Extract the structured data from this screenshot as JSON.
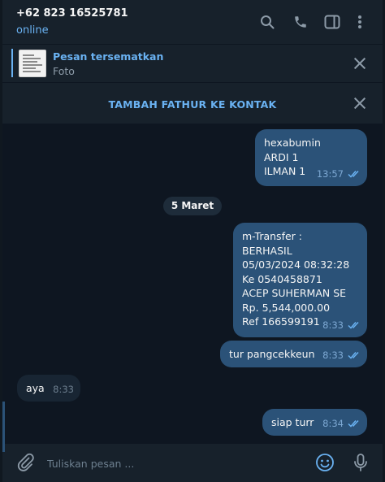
{
  "header": {
    "contact_name": "+62 823 16525781",
    "status": "online",
    "icons": [
      "search-icon",
      "phone-icon",
      "sidebar-toggle-icon",
      "more-vertical-icon"
    ]
  },
  "pinned": {
    "title": "Pesan tersematkan",
    "subtitle": "Foto"
  },
  "add_contact": {
    "label": "TAMBAH FATHUR KE KONTAK"
  },
  "date_separator": "5 Maret",
  "messages": [
    {
      "direction": "out",
      "lines": [
        "hexabumin",
        "ARDI 1",
        "ILMAN 1"
      ],
      "time": "13:57",
      "read": true
    },
    {
      "direction": "out",
      "lines": [
        "m-Transfer :",
        "BERHASIL",
        "05/03/2024 08:32:28",
        "Ke 0540458871",
        "ACEP SUHERMAN SE",
        "Rp. 5,544,000.00",
        "Ref 166599191"
      ],
      "time": "8:33",
      "read": true
    },
    {
      "direction": "out",
      "lines": [
        "tur pangcekkeun"
      ],
      "time": "8:33",
      "read": true
    },
    {
      "direction": "in",
      "lines": [
        "aya"
      ],
      "time": "8:33"
    },
    {
      "direction": "out",
      "lines": [
        "siap turr"
      ],
      "time": "8:34",
      "read": true
    }
  ],
  "composer": {
    "placeholder": "Tuliskan pesan ...",
    "icons": [
      "attach-icon",
      "emoji-icon",
      "microphone-icon"
    ]
  },
  "colors": {
    "background": "#0e1621",
    "panel": "#17212b",
    "outgoing_bubble": "#2b5278",
    "incoming_bubble": "#182533",
    "accent": "#6ab2f2"
  }
}
